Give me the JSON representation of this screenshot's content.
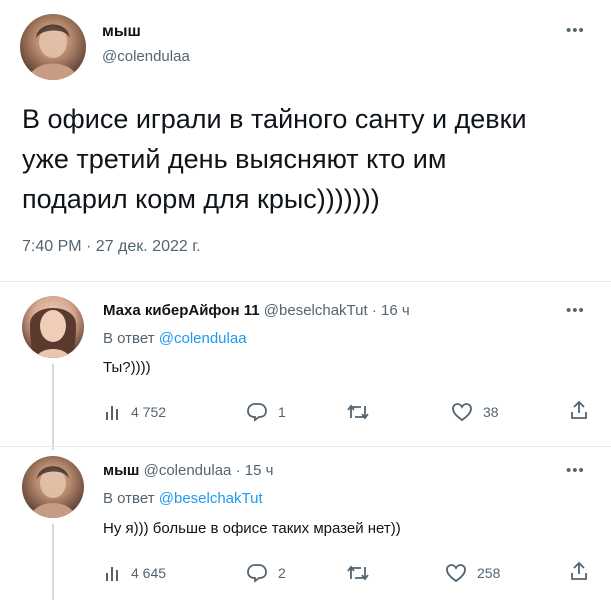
{
  "main_tweet": {
    "author_name": "мыш",
    "author_handle": "@colendulaa",
    "text_lines": [
      "В офисе играли в тайного санту и девки",
      "уже третий день выясняют кто им",
      "подарил корм для крыс)))))))"
    ],
    "timestamp": "7:40 PM · 27 дек. 2022 г."
  },
  "replies": [
    {
      "author_name": "Маха киберАйфон 11",
      "author_handle": "@beselchakTut",
      "time": "· 16 ч",
      "reply_prefix": "В ответ",
      "reply_to": "@colendulaa",
      "text": "Ты?))))",
      "views": "4 752",
      "replies": "1",
      "retweets": "",
      "likes": "38"
    },
    {
      "author_name": "мыш",
      "author_handle": "@colendulaa",
      "time": "· 15 ч",
      "reply_prefix": "В ответ",
      "reply_to": "@beselchakTut",
      "text": "Ну я))) больше в офисе таких мразей нет))",
      "views": "4 645",
      "replies": "2",
      "retweets": "",
      "likes": "258"
    }
  ],
  "colors": {
    "link": "#1d9bf0",
    "muted": "#536471",
    "text": "#0f1419"
  }
}
